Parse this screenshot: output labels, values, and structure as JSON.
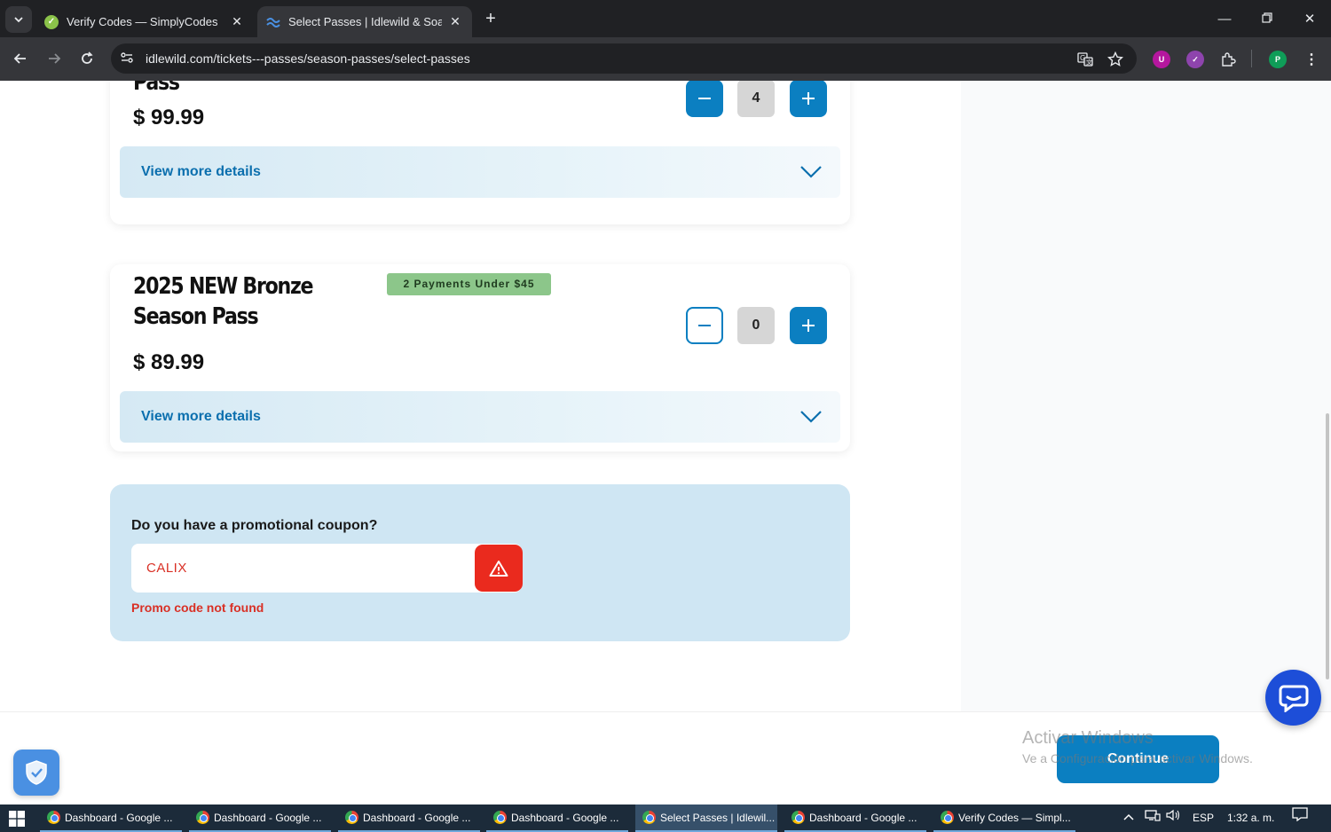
{
  "browser": {
    "tabs": [
      {
        "title": "Verify Codes — SimplyCodes",
        "active": false
      },
      {
        "title": "Select Passes | Idlewild & SoakZone",
        "active": true
      }
    ],
    "url": "idlewild.com/tickets---passes/season-passes/select-passes",
    "profile_initial": "P",
    "ublock_label": "U"
  },
  "passes": [
    {
      "name": "Pass",
      "price": "$ 99.99",
      "quantity": "4",
      "details_label": "View more details"
    },
    {
      "name": "2025 NEW Bronze Season Pass",
      "badge": "2 Payments Under $45",
      "price": "$ 89.99",
      "quantity": "0",
      "details_label": "View more details"
    }
  ],
  "promo": {
    "question": "Do you have a promotional coupon?",
    "code_value": "CALIX",
    "error": "Promo code not found"
  },
  "actions": {
    "continue_label": "Continue"
  },
  "watermark": {
    "title": "Activar Windows",
    "subtitle": "Ve a Configuración para activar Windows."
  },
  "taskbar": {
    "items": [
      {
        "label": "Dashboard - Google ...",
        "active": false
      },
      {
        "label": "Dashboard - Google ...",
        "active": false
      },
      {
        "label": "Dashboard - Google ...",
        "active": false
      },
      {
        "label": "Dashboard - Google ...",
        "active": false
      },
      {
        "label": "Select Passes | Idlewil...",
        "active": true
      },
      {
        "label": "Dashboard - Google ...",
        "active": false
      },
      {
        "label": "Verify Codes — Simpl...",
        "active": false
      }
    ],
    "language": "ESP",
    "time": "1:32 a. m."
  },
  "colors": {
    "brand_blue": "#0b7fc1",
    "error_red": "#d93025",
    "badge_green": "#8cc68a",
    "promo_bg": "#cfe6f3"
  }
}
